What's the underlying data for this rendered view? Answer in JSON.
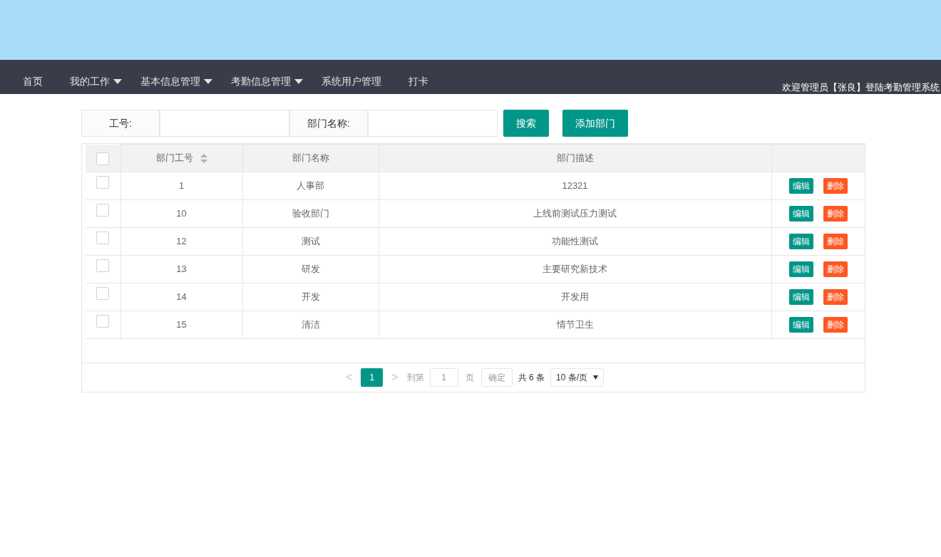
{
  "nav": {
    "items": [
      {
        "label": "首页",
        "dropdown": false
      },
      {
        "label": "我的工作",
        "dropdown": true
      },
      {
        "label": "基本信息管理",
        "dropdown": true
      },
      {
        "label": "考勤信息管理",
        "dropdown": true
      },
      {
        "label": "系统用户管理",
        "dropdown": false
      },
      {
        "label": "打卡",
        "dropdown": false
      }
    ],
    "welcome": "欢迎管理员【张良】登陆考勤管理系统"
  },
  "search": {
    "fields": [
      {
        "label": "工号:"
      },
      {
        "label": "部门名称:"
      }
    ],
    "buttons": [
      "搜索",
      "添加部门"
    ]
  },
  "table": {
    "select_all": {
      "checked": false
    },
    "columns": [
      {
        "label": "部门工号",
        "sortable": true
      },
      {
        "label": "部门名称",
        "sortable": false
      },
      {
        "label": "部门描述",
        "sortable": false
      }
    ],
    "rows": [
      {
        "checked": false,
        "cells": [
          "1",
          "人事部",
          "12321"
        ],
        "actions": [
          "编辑",
          "删除"
        ]
      },
      {
        "checked": false,
        "cells": [
          "10",
          "验收部门",
          "上线前测试压力测试"
        ],
        "actions": [
          "编辑",
          "删除"
        ]
      },
      {
        "checked": false,
        "cells": [
          "12",
          "测试",
          "功能性测试"
        ],
        "actions": [
          "编辑",
          "删除"
        ]
      },
      {
        "checked": false,
        "cells": [
          "13",
          "研发",
          "主要研究新技术"
        ],
        "actions": [
          "编辑",
          "删除"
        ]
      },
      {
        "checked": false,
        "cells": [
          "14",
          "开发",
          "开发用"
        ],
        "actions": [
          "编辑",
          "删除"
        ]
      },
      {
        "checked": false,
        "cells": [
          "15",
          "清洁",
          "情节卫生"
        ],
        "actions": [
          "编辑",
          "删除"
        ]
      }
    ]
  },
  "pagination": {
    "prev": "<",
    "pages": [
      {
        "label": "1",
        "selected": true
      }
    ],
    "next": ">",
    "goto_label": "到第",
    "goto_value": "1",
    "page_unit": "页",
    "confirm": "确定",
    "total": "共 6 条",
    "page_size": "10 条/页"
  }
}
